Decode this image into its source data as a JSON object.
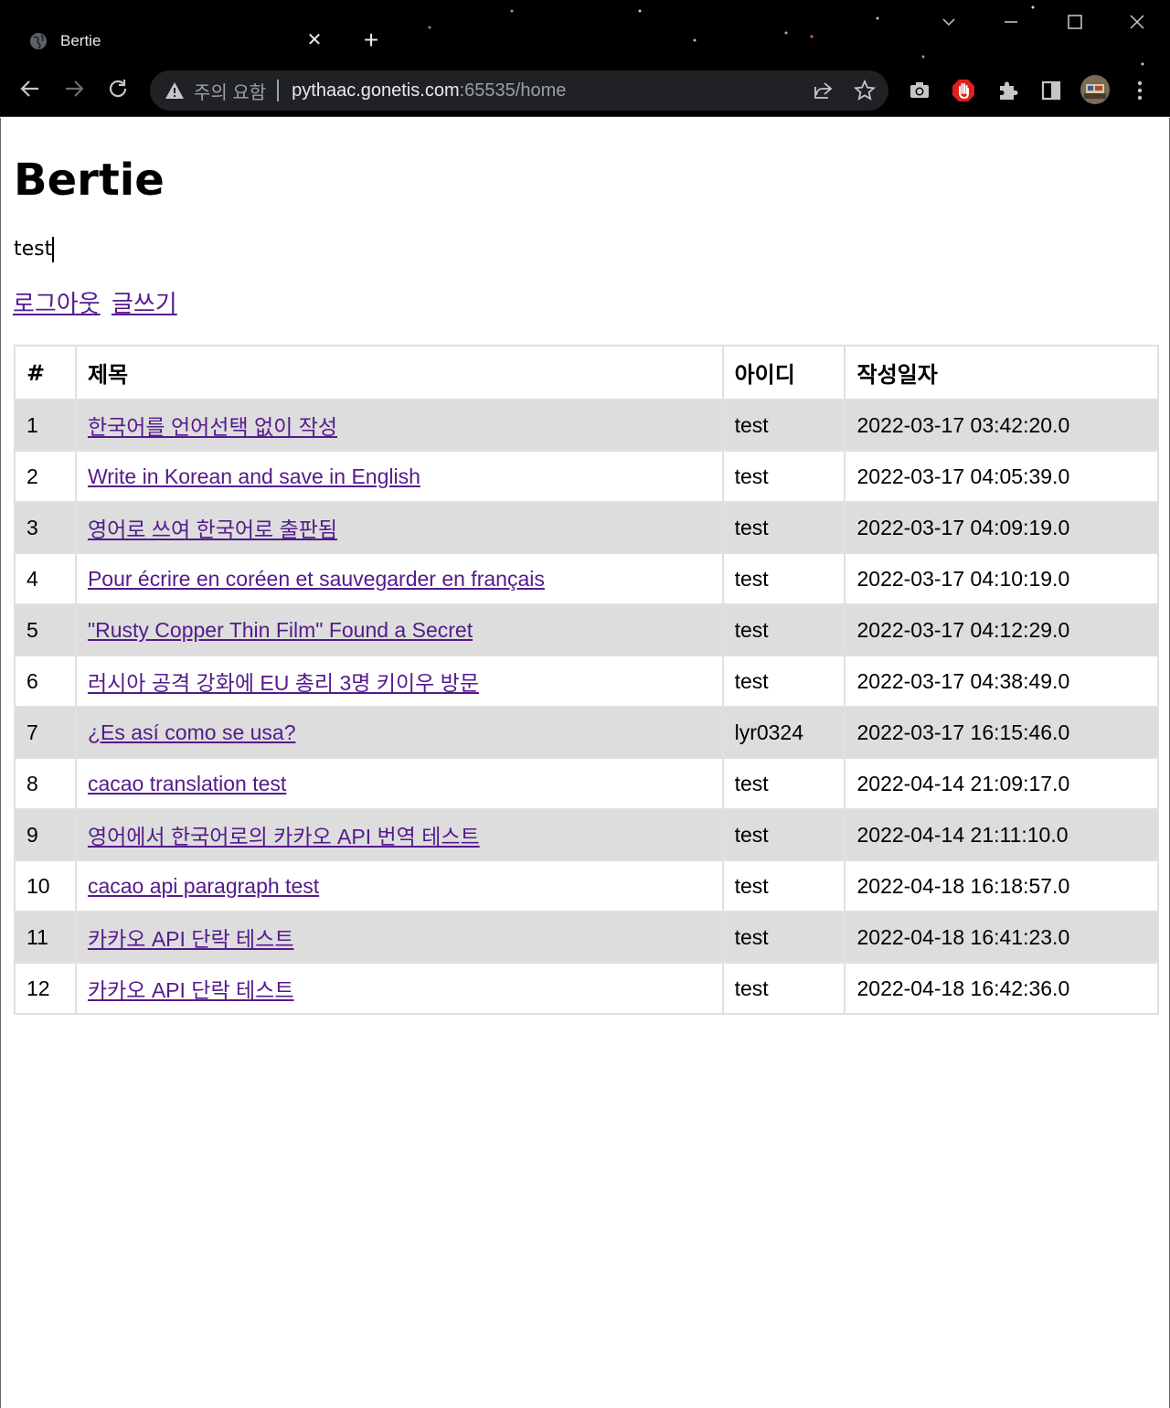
{
  "browser": {
    "tab_title": "Bertie",
    "security_label": "주의 요함",
    "url_host": "pythaac.gonetis.com",
    "url_rest": ":65535/home"
  },
  "page": {
    "heading": "Bertie",
    "username": "test",
    "links": {
      "logout": "로그아웃",
      "write": "글쓰기"
    }
  },
  "table": {
    "headers": {
      "num": "#",
      "title": "제목",
      "author": "아이디",
      "date": "작성일자"
    },
    "rows": [
      {
        "num": "1",
        "title": "한국어를 언어선택 없이 작성",
        "author": "test",
        "date": "2022-03-17 03:42:20.0"
      },
      {
        "num": "2",
        "title": "Write in Korean and save in English",
        "author": "test",
        "date": "2022-03-17 04:05:39.0"
      },
      {
        "num": "3",
        "title": "영어로 쓰여 한국어로 출판됨",
        "author": "test",
        "date": "2022-03-17 04:09:19.0"
      },
      {
        "num": "4",
        "title": "Pour écrire en coréen et sauvegarder en français",
        "author": "test",
        "date": "2022-03-17 04:10:19.0"
      },
      {
        "num": "5",
        "title": "\"Rusty Copper Thin Film\" Found a Secret",
        "author": "test",
        "date": "2022-03-17 04:12:29.0"
      },
      {
        "num": "6",
        "title": "러시아 공격 강화에 EU 총리 3명 키이우 방문",
        "author": "test",
        "date": "2022-03-17 04:38:49.0"
      },
      {
        "num": "7",
        "title": "¿Es así como se usa?",
        "author": "lyr0324",
        "date": "2022-03-17 16:15:46.0"
      },
      {
        "num": "8",
        "title": "cacao translation test",
        "author": "test",
        "date": "2022-04-14 21:09:17.0"
      },
      {
        "num": "9",
        "title": "영어에서 한국어로의 카카오 API 번역 테스트",
        "author": "test",
        "date": "2022-04-14 21:11:10.0"
      },
      {
        "num": "10",
        "title": "cacao api paragraph test",
        "author": "test",
        "date": "2022-04-18 16:18:57.0"
      },
      {
        "num": "11",
        "title": "카카오 API 단락 테스트",
        "author": "test",
        "date": "2022-04-18 16:41:23.0"
      },
      {
        "num": "12",
        "title": "카카오 API 단락 테스트",
        "author": "test",
        "date": "2022-04-18 16:42:36.0"
      }
    ]
  },
  "icons": {
    "favicon": "globe-icon",
    "tab_close": "close-icon",
    "new_tab": "plus-icon",
    "back": "back-arrow-icon",
    "forward": "forward-arrow-icon",
    "reload": "reload-icon",
    "security": "warning-triangle-icon",
    "share": "share-icon",
    "bookmark": "star-icon",
    "screenshot": "camera-icon",
    "adblock": "stop-hand-icon",
    "extensions": "puzzle-icon",
    "sidepanel": "side-panel-icon",
    "profile": "avatar",
    "menu": "kebab-menu-icon"
  },
  "colors": {
    "link_visited": "#551a8b",
    "row_alt": "#dddddd",
    "chrome_bg": "#000000",
    "omnibox_bg": "#202124"
  }
}
